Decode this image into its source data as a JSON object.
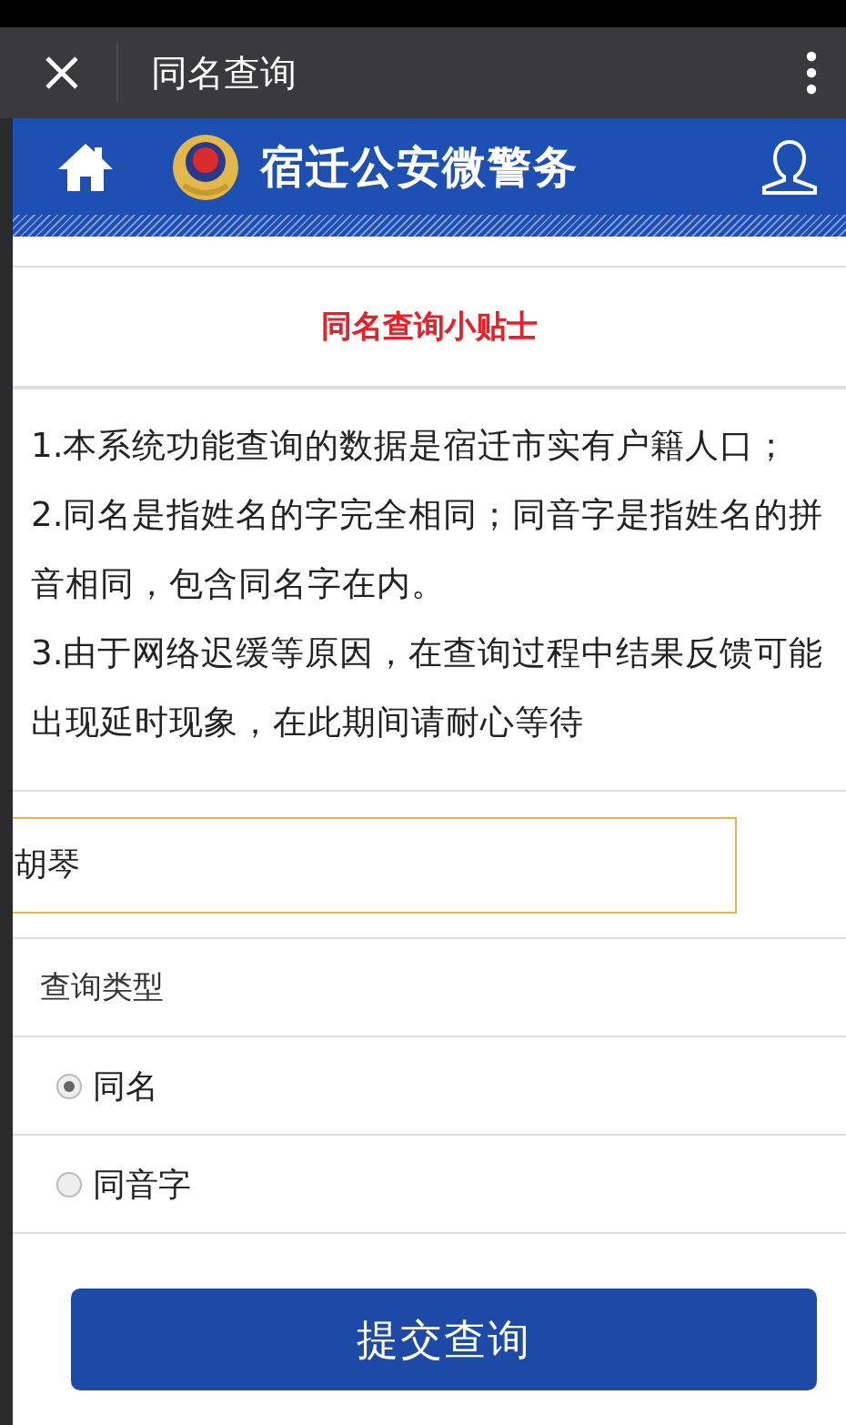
{
  "topbar": {
    "title": "同名查询"
  },
  "header": {
    "title": "宿迁公安微警务"
  },
  "tips": {
    "title": "同名查询小贴士",
    "items": [
      "1.本系统功能查询的数据是宿迁市实有户籍人口；",
      "2.同名是指姓名的字完全相同；同音字是指姓名的拼音相同，包含同名字在内。",
      "3.由于网络迟缓等原因，在查询过程中结果反馈可能出现延时现象，在此期间请耐心等待"
    ]
  },
  "form": {
    "name_field": {
      "value": "胡琴",
      "focused": true
    },
    "type_label": "查询类型",
    "options": [
      {
        "label": "同名",
        "selected": true
      },
      {
        "label": "同音字",
        "selected": false
      }
    ],
    "submit": "提交查询"
  }
}
